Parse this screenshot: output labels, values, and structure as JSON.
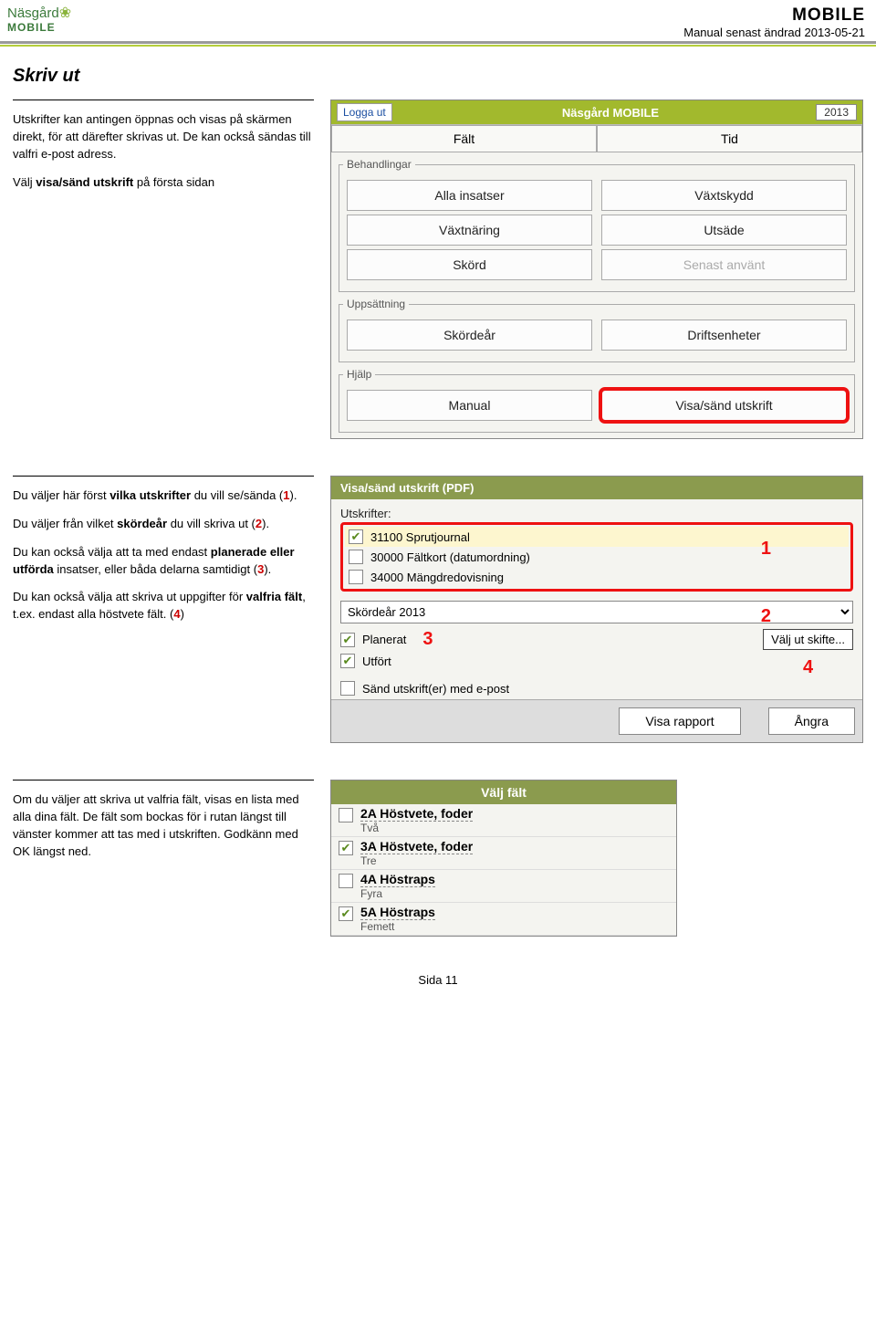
{
  "header": {
    "logo_line1": "Näsgård",
    "logo_line2": "MOBILE",
    "title_right": "MOBILE",
    "subtitle_right": "Manual senast ändrad 2013-05-21"
  },
  "section1": {
    "title": "Skriv ut",
    "para1": "Utskrifter kan antingen öppnas och visas på skärmen direkt, för att därefter skrivas ut. De kan också sändas till valfri e-post adress.",
    "para2_pre": "Välj ",
    "para2_bold": "visa/sänd utskrift",
    "para2_post": " på första sidan"
  },
  "screenshot1": {
    "logout": "Logga ut",
    "title": "Näsgård MOBILE",
    "year": "2013",
    "tab_left": "Fält",
    "tab_right": "Tid",
    "grp_behandlingar": "Behandlingar",
    "btn_alla": "Alla insatser",
    "btn_vaxtskydd": "Växtskydd",
    "btn_vaxtnaring": "Växtnäring",
    "btn_utsade": "Utsäde",
    "btn_skord": "Skörd",
    "btn_senast": "Senast använt",
    "grp_uppsatt": "Uppsättning",
    "btn_skordear": "Skördeår",
    "btn_drift": "Driftsenheter",
    "grp_hjalp": "Hjälp",
    "btn_manual": "Manual",
    "btn_visasand": "Visa/sänd utskrift"
  },
  "section2": {
    "p1a": "Du väljer här först ",
    "p1b": "vilka utskrifter",
    "p1c": " du vill se/sända (",
    "p1n": "1",
    "p1d": ").",
    "p2a": "Du väljer från vilket ",
    "p2b": "skördeår",
    "p2c": " du vill skriva ut (",
    "p2n": "2",
    "p2d": ").",
    "p3a": "Du kan också välja att ta med endast ",
    "p3b": "planerade eller utförda",
    "p3c": " insatser, eller båda delarna samtidigt (",
    "p3n": "3",
    "p3d": ").",
    "p4a": "Du kan också välja att skriva ut uppgifter för ",
    "p4b": "valfria fält",
    "p4c": ", t.ex. endast alla höstvete fält. (",
    "p4n": "4",
    "p4d": ")"
  },
  "screenshot2": {
    "hdr": "Visa/sänd utskrift (PDF)",
    "label_utskrifter": "Utskrifter:",
    "row1": "31100 Sprutjournal",
    "row2": "30000 Fältkort (datumordning)",
    "row3": "34000 Mängdredovisning",
    "sel_year": "Skördeår 2013",
    "cb_plan": "Planerat",
    "cb_utf": "Utfört",
    "cb_sand": "Sänd utskrift(er) med e-post",
    "btn_valj_skifte": "Välj ut skifte...",
    "btn_visa": "Visa rapport",
    "btn_angra": "Ångra",
    "a1": "1",
    "a2": "2",
    "a3": "3",
    "a4": "4"
  },
  "section3": {
    "p": "Om du väljer att skriva ut valfria fält, visas en lista med alla dina fält. De fält som bockas för i rutan längst till vänster kommer att tas med i utskriften. Godkänn med OK längst ned."
  },
  "screenshot3": {
    "hdr": "Välj fält",
    "rows": [
      {
        "id": "2A",
        "name": "Höstvete, foder",
        "sub": "Två",
        "on": false
      },
      {
        "id": "3A",
        "name": "Höstvete, foder",
        "sub": "Tre",
        "on": true
      },
      {
        "id": "4A",
        "name": "Höstraps",
        "sub": "Fyra",
        "on": false
      },
      {
        "id": "5A",
        "name": "Höstraps",
        "sub": "Femett",
        "on": true
      }
    ]
  },
  "footer": "Sida 11"
}
